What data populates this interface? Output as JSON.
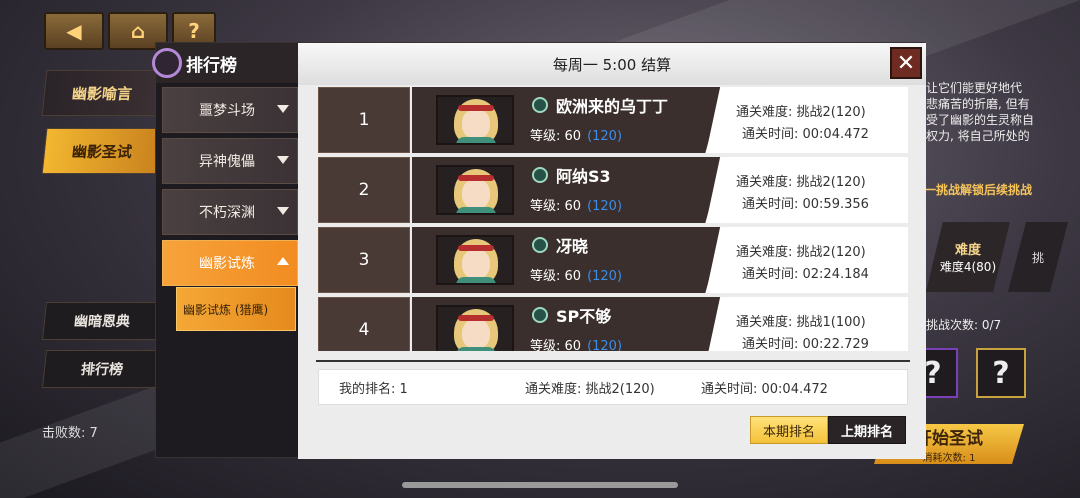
{
  "nav": {
    "back_icon": "back-arrow-icon",
    "home_icon": "home-icon",
    "help_label": "?"
  },
  "left_tabs": {
    "tab1": "幽影喻言",
    "tab2": "幽影圣试",
    "tab3": "幽暗恩典",
    "tab4": "排行榜"
  },
  "defeat_count": "击败数: 7",
  "right": {
    "lore": "让它们能更好地代 悲痛苦的折磨, 但有 受了幽影的生灵称自 权力, 将自己所处的",
    "unlock_hint": "一挑战解锁后续挑战",
    "difficulty_label": "难度",
    "difficulty_value": "难度4(80)",
    "difficulty_next": "挑",
    "challenge_count": "挑战次数: 0/7",
    "q1": "?",
    "q2": "?",
    "start_label": "开始圣试",
    "start_cost": "消耗次数: 1"
  },
  "leaderboard": {
    "title": "排行榜",
    "settle_text": "每周一 5:00 结算",
    "close_label": "✕",
    "categories": [
      "噩梦斗场",
      "异神傀儡",
      "不朽深渊",
      "幽影试炼"
    ],
    "subcategory": "幽影试炼 (猎鹰)",
    "rows": [
      {
        "rank": "1",
        "name": "欧洲来的乌丁丁",
        "level_label": "等级: 60",
        "level_extra": "(120)",
        "difficulty": "通关难度: 挑战2(120)",
        "time": "通关时间: 00:04.472"
      },
      {
        "rank": "2",
        "name": "阿纳S3",
        "level_label": "等级: 60",
        "level_extra": "(120)",
        "difficulty": "通关难度: 挑战2(120)",
        "time": "通关时间: 00:59.356"
      },
      {
        "rank": "3",
        "name": "冴晓",
        "level_label": "等级: 60",
        "level_extra": "(120)",
        "difficulty": "通关难度: 挑战2(120)",
        "time": "通关时间: 02:24.184"
      },
      {
        "rank": "4",
        "name": "SP不够",
        "level_label": "等级: 60",
        "level_extra": "(120)",
        "difficulty": "通关难度: 挑战1(100)",
        "time": "通关时间: 00:22.729"
      }
    ],
    "my_rank": "我的排名: 1",
    "my_difficulty": "通关难度: 挑战2(120)",
    "my_time": "通关时间: 00:04.472",
    "tab_this_period": "本期排名",
    "tab_last_period": "上期排名"
  }
}
